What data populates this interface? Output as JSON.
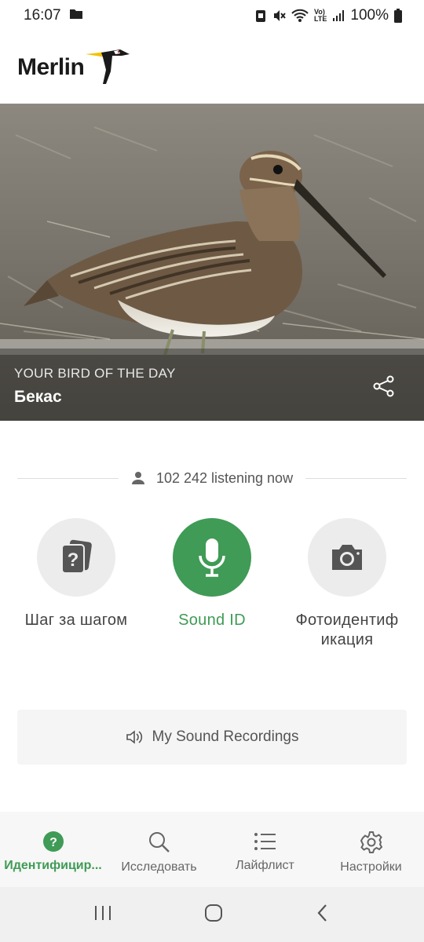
{
  "status": {
    "time": "16:07",
    "battery": "100%"
  },
  "header": {
    "logo_text": "Merlin"
  },
  "hero": {
    "label": "YOUR BIRD OF THE DAY",
    "bird_name": "Бекас"
  },
  "listening": {
    "text": "102 242 listening now"
  },
  "actions": {
    "step": "Шаг за шагом",
    "sound": "Sound ID",
    "photo_line1": "Фотоидентиф",
    "photo_line2": "икация"
  },
  "recordings": {
    "label": "My Sound Recordings"
  },
  "nav": {
    "identify": "Идентифицир...",
    "explore": "Исследовать",
    "lifelist": "Лайфлист",
    "settings": "Настройки"
  },
  "colors": {
    "accent": "#3f9b55"
  }
}
